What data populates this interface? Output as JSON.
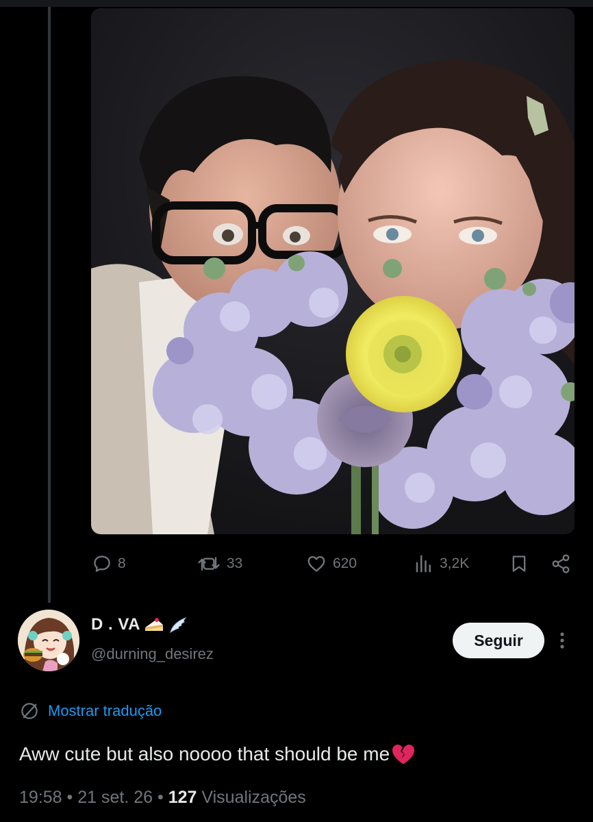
{
  "post": {
    "image_alt": "Selfie of a couple hiding behind a bouquet of lavender and yellow flowers",
    "actions": {
      "replies": "8",
      "reposts": "33",
      "likes": "620",
      "views": "3,2K"
    }
  },
  "reply": {
    "display_name": "D . VA",
    "name_emojis": [
      "cake-slice-icon",
      "wing-icon"
    ],
    "handle": "@durning_desirez",
    "follow_label": "Seguir",
    "translate_label": "Mostrar tradução",
    "text": "Aww cute but also noooo that should be me",
    "text_emoji": "broken-heart-icon",
    "time": "19:58",
    "date": "21 set. 26",
    "views_count": "127",
    "views_label": "Visualizações",
    "separator": "•"
  },
  "colors": {
    "background": "#000000",
    "text_primary": "#e7e9ea",
    "text_secondary": "#71767b",
    "link": "#1d9bf0",
    "follow_bg": "#eff3f4",
    "broken_heart": "#e0245e"
  }
}
